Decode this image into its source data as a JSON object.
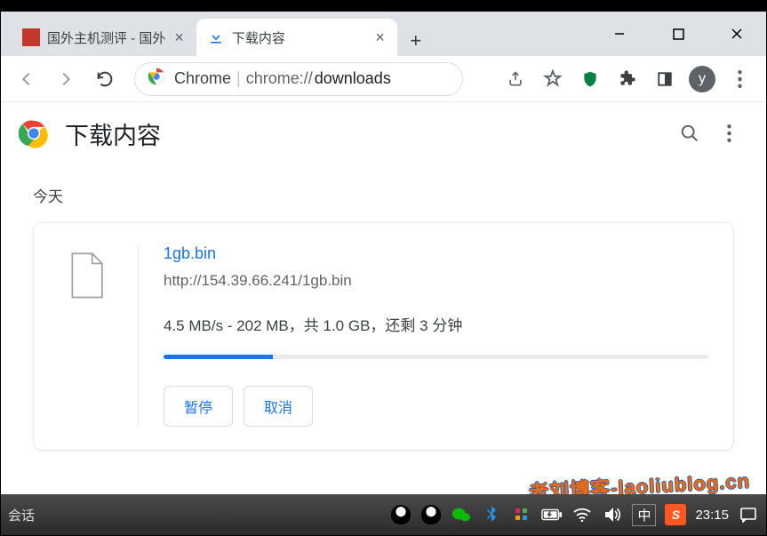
{
  "window": {
    "minimize": "—",
    "maximize": "▢",
    "close": "✕"
  },
  "tabs": {
    "inactive": {
      "title": "国外主机测评 - 国外"
    },
    "active": {
      "title": "下载内容"
    },
    "newtab": "+"
  },
  "toolbar": {
    "omnibox": {
      "scheme": "Chrome",
      "divider": "|",
      "host_prefix": "chrome://",
      "host_bold": "downloads"
    }
  },
  "page_header": {
    "title": "下载内容"
  },
  "section": {
    "label": "今天"
  },
  "download": {
    "filename": "1gb.bin",
    "url": "http://154.39.66.241/1gb.bin",
    "status": "4.5 MB/s - 202 MB，共 1.0 GB，还剩 3 分钟",
    "progress_pct": 20,
    "pause": "暂停",
    "cancel": "取消"
  },
  "taskbar": {
    "left": "会话",
    "ime": "中",
    "sogou": "S",
    "clock": "23:15"
  },
  "watermark": "老刘博客-laoliublog.cn",
  "avatar": "y"
}
